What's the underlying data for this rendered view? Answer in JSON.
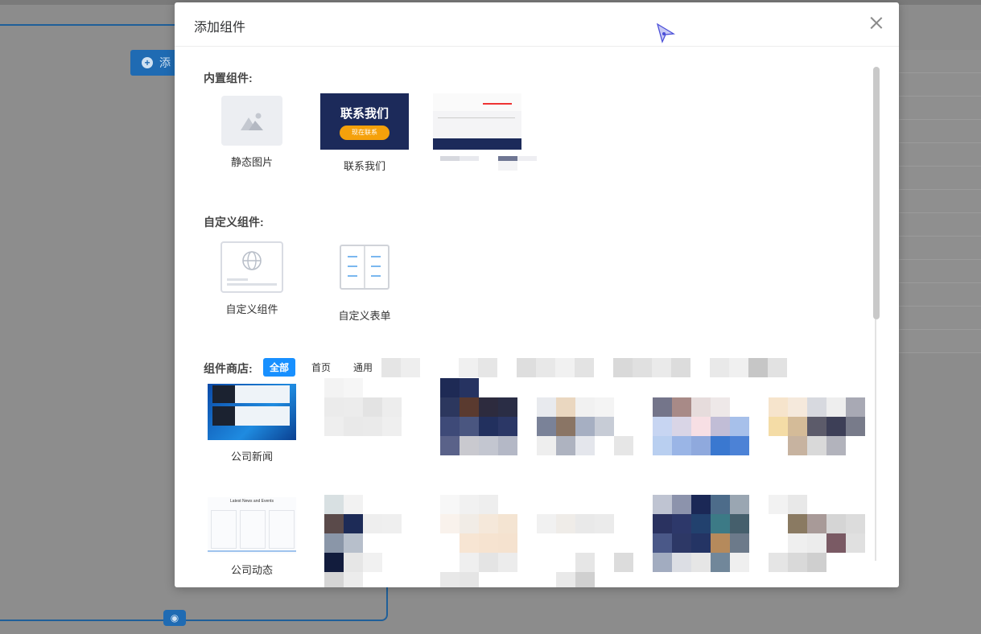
{
  "background": {
    "add_button_label": "添",
    "eye_icon": "eye-icon"
  },
  "modal": {
    "title": "添加组件",
    "close_icon": "close-icon"
  },
  "builtin": {
    "section_title": "内置组件:",
    "items": [
      {
        "label": "静态图片",
        "icon": "image-placeholder-icon"
      },
      {
        "label": "联系我们",
        "thumb_title": "联系我们",
        "thumb_button": "现在联系"
      }
    ]
  },
  "custom": {
    "section_title": "自定义组件:",
    "items": [
      {
        "label": "自定义组件",
        "icon": "globe-icon"
      },
      {
        "label": "自定义表单",
        "icon": "form-icon"
      }
    ]
  },
  "store": {
    "section_title": "组件商店:",
    "tabs": [
      "全部",
      "首页",
      "通用"
    ],
    "active_tab": "全部",
    "items": [
      {
        "label": "公司新闻"
      },
      {
        "label": "公司动态",
        "thumb_title": "Latest News and Events"
      }
    ]
  },
  "colors": {
    "accent": "#1890ff",
    "contact_bg": "#1c2a5a",
    "contact_button": "#f5a10b"
  }
}
